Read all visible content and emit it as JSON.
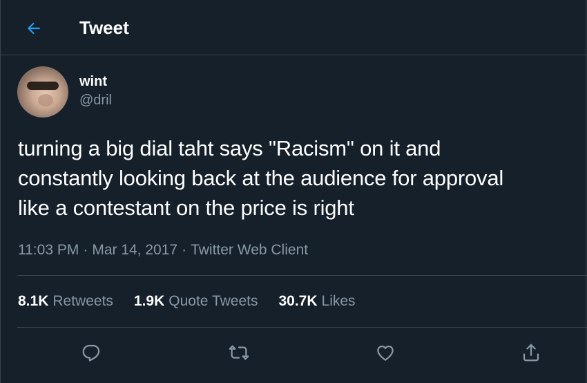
{
  "header": {
    "title": "Tweet",
    "back_icon": "arrow-left-icon"
  },
  "author": {
    "name": "wint",
    "handle": "@dril"
  },
  "tweet": {
    "text_lines": [
      "turning a big dial taht says \"Racism\" on it and",
      "constantly looking back at the audience for approval",
      "like a contestant on the price is right"
    ],
    "time": "11:03 PM",
    "separator": "·",
    "date": "Mar 14, 2017",
    "client": "Twitter Web Client"
  },
  "stats": {
    "retweets": {
      "count": "8.1K",
      "label": "Retweets"
    },
    "quote_tweets": {
      "count": "1.9K",
      "label": "Quote Tweets"
    },
    "likes": {
      "count": "30.7K",
      "label": "Likes"
    }
  },
  "actions": [
    {
      "icon": "reply-icon"
    },
    {
      "icon": "retweet-icon"
    },
    {
      "icon": "like-icon"
    },
    {
      "icon": "share-icon"
    }
  ],
  "colors": {
    "background": "#15202b",
    "border": "#38444d",
    "muted_text": "#8899a6",
    "accent": "#1da1f2"
  }
}
